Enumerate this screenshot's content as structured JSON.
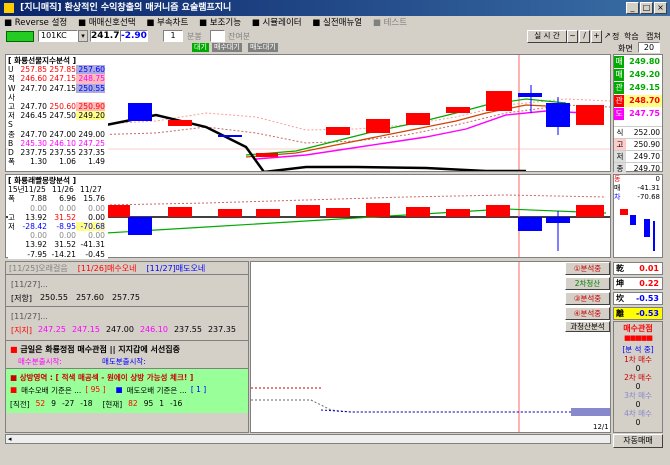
{
  "title": "[지니매직] 환상적인 수익창출의 매커니즘 요술램프지니",
  "menu": [
    "Reverse 설정",
    "매매신호선택",
    "부속차트",
    "보조기능",
    "시뮬레이터",
    "실전매뉴얼",
    "테스트"
  ],
  "toolbar": {
    "code": "101KC",
    "price": "241.70",
    "change": "-2.90",
    "period": "1",
    "period_unit": "분봉",
    "remain_label": "잔여분",
    "buttons": [
      "실 시 간",
      "~",
      "/",
      "+",
      "정",
      "학습",
      "캡쳐"
    ],
    "screen_label": "화면",
    "screen_value": "20"
  },
  "subtabs": [
    "대기",
    "매수대기",
    "매도대기"
  ],
  "panel1": {
    "title": "[ 화룡선물지수분석 ]",
    "rows": [
      {
        "k": "U",
        "v": [
          "257.85",
          "257.85",
          "257.60"
        ]
      },
      {
        "k": "적",
        "v": [
          "246.60",
          "247.15",
          "248.75"
        ]
      },
      {
        "k": "W",
        "v": [
          "247.70",
          "247.15",
          "250.55"
        ]
      },
      {
        "k": "사",
        "v": [
          "",
          "",
          ""
        ]
      },
      {
        "k": "고",
        "v": [
          "247.70",
          "250.60",
          "250.90"
        ]
      },
      {
        "k": "저",
        "v": [
          "246.45",
          "247.50",
          "249.20"
        ]
      },
      {
        "k": "S",
        "v": [
          "",
          "",
          ""
        ]
      },
      {
        "k": "종",
        "v": [
          "247.70",
          "247.00",
          "249.00"
        ]
      },
      {
        "k": "B",
        "v": [
          "245.30",
          "246.10",
          "247.25"
        ]
      },
      {
        "k": "D",
        "v": [
          "237.75",
          "237.55",
          "237.35"
        ]
      },
      {
        "k": "폭",
        "v": [
          "1.30",
          "1.06",
          "1.49"
        ]
      }
    ]
  },
  "panel2": {
    "title": "[ 화룡래빨몽량분석 ]",
    "head": [
      "15년",
      "11/25",
      "11/26",
      "11/27"
    ],
    "rows": [
      {
        "k": "폭",
        "v": [
          "7.88",
          "6.96",
          "15.76"
        ]
      },
      {
        "k": "",
        "v": [
          "0.00",
          "0.00",
          "0.00"
        ]
      },
      {
        "k": "고",
        "v": [
          "13.92",
          "31.52",
          "0.00"
        ]
      },
      {
        "k": "저",
        "v": [
          "-28.42",
          "-8.95",
          "-70.68"
        ]
      },
      {
        "k": "",
        "v": [
          "0.00",
          "0.00",
          "0.00"
        ]
      },
      {
        "k": "",
        "v": [
          "13.92",
          "31.52",
          "-41.31"
        ]
      },
      {
        "k": "",
        "v": [
          "-7.95",
          "-14.21",
          "-0.45"
        ]
      }
    ]
  },
  "right_prices": [
    {
      "label": "매",
      "value": "249.80",
      "color": "#00aa00"
    },
    {
      "label": "매",
      "value": "249.20",
      "color": "#00aa00"
    },
    {
      "label": "관",
      "value": "249.15",
      "color": "#00aa00"
    },
    {
      "label": "관",
      "value": "248.70",
      "color": "#ff0000"
    },
    {
      "label": "도",
      "value": "247.75",
      "color": "#ff00ff"
    }
  ],
  "right_small": [
    {
      "label": "식",
      "value": "252.00"
    },
    {
      "label": "고",
      "value": "250.90"
    },
    {
      "label": "저",
      "value": "249.70"
    },
    {
      "label": "종",
      "value": "249.70"
    }
  ],
  "right2": {
    "rows": [
      {
        "k": "동",
        "v": "0"
      },
      {
        "k": "매",
        "v": "-41.31"
      },
      {
        "k": "차",
        "v": "-70.68"
      }
    ]
  },
  "chart_x_label": "12/1",
  "info": {
    "tabs": [
      "[11/25]오래걸음",
      "[11/26]매수오네",
      "[11/27]매도오네"
    ],
    "line1": "[11/27]...",
    "support": {
      "label": "[저항]",
      "values": [
        "250.55",
        "257.60",
        "257.75"
      ]
    },
    "line2": "[11/27]...",
    "resist": {
      "label": "[지지]",
      "values": [
        "247.25",
        "247.15",
        "247.00",
        "246.10",
        "237.55",
        "237.35"
      ]
    },
    "notice1": "금일은 화룡정점 매수관점 || 지지갑에 서선집중",
    "sub1a": "매수분출시작:",
    "sub1b": "매도분출시작:",
    "notice2": "상방영역 : [ 적색 매공섹 - 원에이 상방 가능성 체크! ]",
    "buy_label": "매수오배 기준은 ...",
    "buy_val": "[ 95 ]",
    "sell_label": "매도오배 기준은 ...",
    "sell_val": "[ 1 ]",
    "bottom_label1": "[직전]",
    "bottom_vals1": [
      "52",
      "9",
      "-27",
      "-18"
    ],
    "bottom_label2": "[현재]",
    "bottom_vals2": [
      "82",
      "95",
      "1",
      "-16"
    ]
  },
  "signals": [
    {
      "label": "①분석중",
      "k": "乾",
      "v": "0.01",
      "bg": "#ffffff"
    },
    {
      "label": "2차청산",
      "k": "坤",
      "v": "0.22",
      "bg": "#ffffff"
    },
    {
      "label": "③분석중",
      "k": "坎",
      "v": "-0.53",
      "bg": "#ffffff"
    },
    {
      "label": "④분석중",
      "k": "離",
      "v": "-0.53",
      "bg": "#ffff00"
    }
  ],
  "signal_extra": "과청산분석",
  "buy_panel": {
    "title": "매수관점",
    "sub": "[분 석 중]",
    "items": [
      "1차 매수",
      "0",
      "2차 매수",
      "0",
      "3차 매수",
      "0",
      "4차 매수",
      "0"
    ]
  },
  "auto_trade": "자동매매",
  "colors": {
    "title": "#0a246a",
    "red": "#ff0000",
    "blue": "#0000ff",
    "green": "#008000",
    "pink": "#ff00ff"
  }
}
